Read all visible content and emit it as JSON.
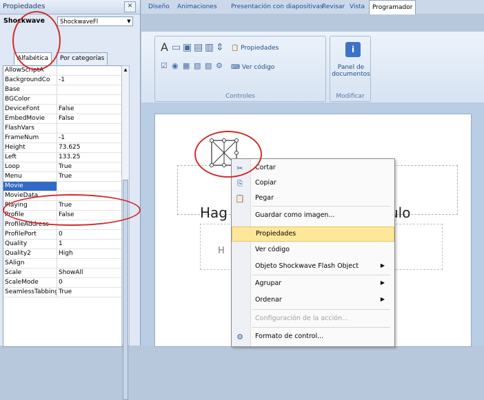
{
  "properties_panel": {
    "title": "Propiedades",
    "close_label": "✕",
    "object_name": "Shockwave",
    "object_type": "ShockwaveFl",
    "tabs": [
      "Alfabética",
      "Por categorías"
    ],
    "rows": [
      {
        "name": "AllowScriptA",
        "value": ""
      },
      {
        "name": "BackgroundCo",
        "value": "-1"
      },
      {
        "name": "Base",
        "value": ""
      },
      {
        "name": "BGColor",
        "value": ""
      },
      {
        "name": "DeviceFont",
        "value": "False"
      },
      {
        "name": "EmbedMovie",
        "value": "False"
      },
      {
        "name": "FlashVars",
        "value": ""
      },
      {
        "name": "FrameNum",
        "value": "-1"
      },
      {
        "name": "Height",
        "value": "73.625"
      },
      {
        "name": "Left",
        "value": "133.25"
      },
      {
        "name": "Loop",
        "value": "True"
      },
      {
        "name": "Menu",
        "value": "True"
      },
      {
        "name": "Movie",
        "value": ""
      },
      {
        "name": "MovieData",
        "value": ""
      },
      {
        "name": "Playing",
        "value": "True"
      },
      {
        "name": "Profile",
        "value": "False"
      },
      {
        "name": "ProfileAddress",
        "value": ""
      },
      {
        "name": "ProfilePort",
        "value": "0"
      },
      {
        "name": "Quality",
        "value": "1"
      },
      {
        "name": "Quality2",
        "value": "High"
      },
      {
        "name": "SAlign",
        "value": ""
      },
      {
        "name": "Scale",
        "value": "ShowAll"
      },
      {
        "name": "ScaleMode",
        "value": "0"
      },
      {
        "name": "SeamlessTabbing",
        "value": "True"
      }
    ],
    "selected_row": "Movie"
  },
  "ribbon": {
    "tabs": [
      "Diseño",
      "Animaciones",
      "Presentación con diapositivas",
      "Revisar",
      "Vista",
      "Programador"
    ],
    "active_tab": "Programador",
    "controls_group": {
      "label": "Controles",
      "properties_label": "Propiedades",
      "view_code_label": "Ver código"
    },
    "modify_group": {
      "label": "Modificar",
      "panel_label": "Panel de documentos"
    }
  },
  "slide": {
    "title_left": "Hag",
    "title_right": "ulo",
    "subtitle_fragment": "H"
  },
  "context_menu": {
    "items": [
      {
        "icon": "scissors-icon",
        "label": "Cortar",
        "submenu": false
      },
      {
        "icon": "copy-icon",
        "label": "Copiar",
        "submenu": false
      },
      {
        "icon": "paste-icon",
        "label": "Pegar",
        "submenu": false
      },
      {
        "icon": "",
        "label": "Guardar como imagen...",
        "submenu": false
      },
      {
        "icon": "",
        "label": "Propiedades",
        "submenu": false,
        "highlighted": true
      },
      {
        "icon": "",
        "label": "Ver código",
        "submenu": false
      },
      {
        "icon": "",
        "label": "Objeto Shockwave Flash Object",
        "submenu": true
      },
      {
        "icon": "",
        "label": "Agrupar",
        "submenu": true
      },
      {
        "icon": "",
        "label": "Ordenar",
        "submenu": true
      },
      {
        "icon": "",
        "label": "Configuración de la acción...",
        "submenu": false,
        "disabled": true
      },
      {
        "icon": "format-icon",
        "label": "Formato de control...",
        "submenu": false
      }
    ]
  },
  "colors": {
    "highlight": "#fde89a",
    "selection": "#3169c6",
    "annotation": "#d42a2a"
  }
}
